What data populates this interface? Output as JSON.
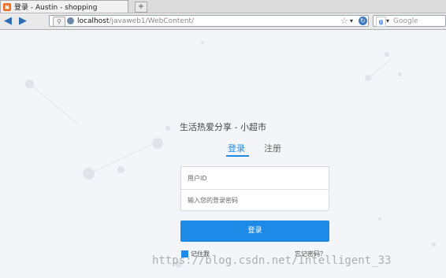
{
  "browser": {
    "tab_title": "登录 - Austin - shopping",
    "new_tab": "+",
    "url_host": "localhost",
    "url_path": "/javaweb1/WebContent/",
    "search_placeholder": "Google"
  },
  "page": {
    "heading": "生活热爱分享 - 小超市",
    "tabs": [
      {
        "label": "登录",
        "active": true
      },
      {
        "label": "注册",
        "active": false
      }
    ],
    "user_id_placeholder": "用户ID",
    "password_placeholder": "输入您的登录密码",
    "login_button": "登录",
    "remember_label": "记住我",
    "remember_checked": true,
    "forgot_label": "忘记密码？",
    "watermark": "https://blog.csdn.net/Intelligent_33"
  },
  "colors": {
    "accent": "#1e8ae8",
    "page_bg": "#f3f5f8"
  }
}
